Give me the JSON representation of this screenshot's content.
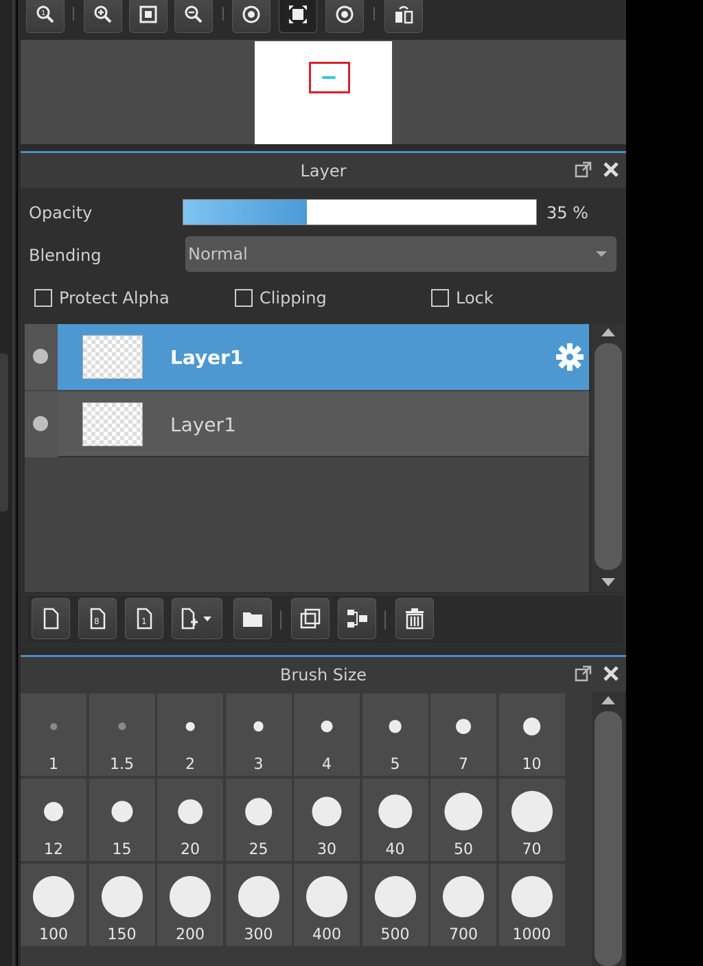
{
  "navigator": {
    "tools": [
      "zoom-actual-icon",
      "zoom-in-icon",
      "fit-icon",
      "zoom-out-icon",
      "rotate-left-icon",
      "reset-view-icon",
      "rotate-right-icon",
      "flip-icon"
    ]
  },
  "layer_panel": {
    "title": "Layer",
    "opacity_label": "Opacity",
    "opacity_value": 0.35,
    "opacity_text": "35 %",
    "blending_label": "Blending",
    "blending_value": "Normal",
    "protect_alpha_label": "Protect Alpha",
    "clipping_label": "Clipping",
    "lock_label": "Lock",
    "layers": [
      {
        "name": "Layer1",
        "selected": true
      },
      {
        "name": "Layer1",
        "selected": false
      }
    ],
    "tools": [
      "new-layer-icon",
      "new-8bit-layer-icon",
      "new-1bit-layer-icon",
      "add-layer-menu-icon",
      "new-folder-icon",
      "duplicate-layer-icon",
      "merge-down-icon",
      "delete-layer-icon"
    ]
  },
  "brush_panel": {
    "title": "Brush Size",
    "sizes": [
      "1",
      "1.5",
      "2",
      "3",
      "4",
      "5",
      "7",
      "10",
      "12",
      "15",
      "20",
      "25",
      "30",
      "40",
      "50",
      "70",
      "100",
      "150",
      "200",
      "300",
      "400",
      "500",
      "700",
      "1000"
    ]
  },
  "colors": {
    "accent": "#4e98d2",
    "panel_bg": "#2b2b2b",
    "nav_view_rect": "#d9202a"
  }
}
